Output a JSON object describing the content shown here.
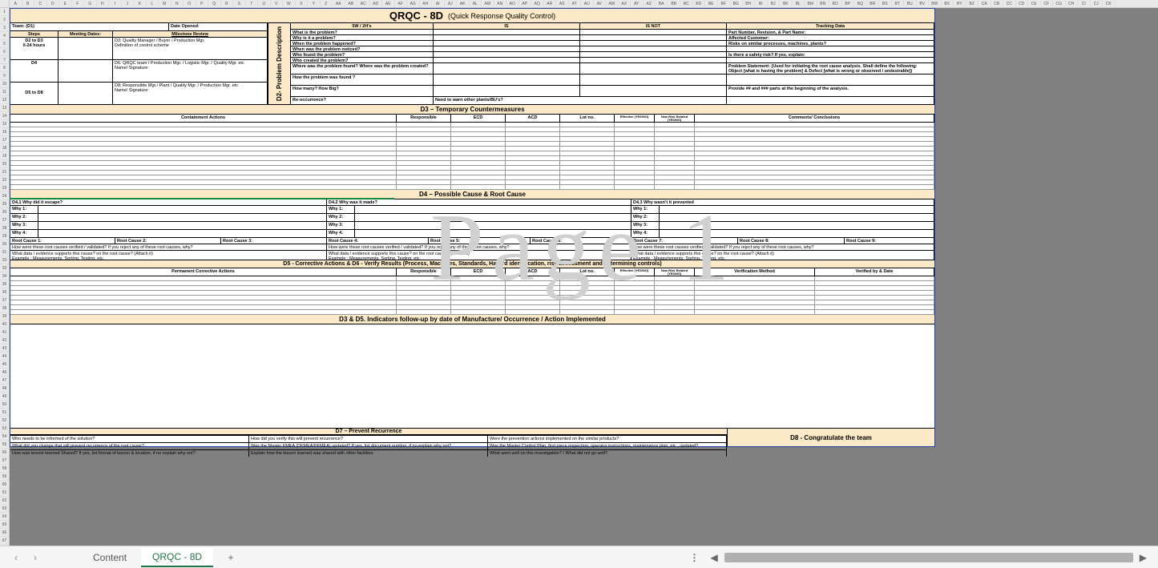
{
  "columns": [
    "A",
    "B",
    "C",
    "D",
    "E",
    "F",
    "G",
    "H",
    "I",
    "J",
    "K",
    "L",
    "M",
    "N",
    "O",
    "P",
    "Q",
    "R",
    "S",
    "T",
    "U",
    "V",
    "W",
    "X",
    "Y",
    "Z",
    "AA",
    "AB",
    "AC",
    "AD",
    "AE",
    "AF",
    "AG",
    "AH",
    "AI",
    "AJ",
    "AK",
    "AL",
    "AM",
    "AN",
    "AO",
    "AP",
    "AQ",
    "AR",
    "AS",
    "AT",
    "AU",
    "AV",
    "AW",
    "AX",
    "AY",
    "AZ",
    "BA",
    "BB",
    "BC",
    "BD",
    "BE",
    "BF",
    "BG",
    "BH",
    "BI",
    "BJ",
    "BK",
    "BL",
    "BM",
    "BN",
    "BO",
    "BP",
    "BQ",
    "BR",
    "BS",
    "BT",
    "BU",
    "BV",
    "BW",
    "BX",
    "BY",
    "BZ",
    "CA",
    "CB",
    "CC",
    "CD",
    "CE",
    "CF",
    "CG",
    "CH",
    "CI",
    "CJ",
    "CK"
  ],
  "title": {
    "main": "QRQC - 8D",
    "sub": "(Quick Response Quality Control)"
  },
  "watermark": "Page 1",
  "d1": {
    "team": "Team: (D1)",
    "date_opened": "Date Opened:",
    "steps": "Steps",
    "meeting_dates": "Meeting Dates:",
    "milestone": "Milestone Review",
    "row1_a": "D2 to D3\n0-24 hours",
    "row1_c": "D3: Quality Manager / Buyer / Production Mgr.\nDefinition of control scheme",
    "row2_a": "D4",
    "row2_c": "D6: QRQC team / Production Mgr. / Logistic Mgr. / Quality Mgr. etc\nName/ Signature:",
    "row3_a": "D5 to D8",
    "row3_c": "D8: Responsible Mgr./ Plant / Quality Mgr. / Production Mgr. etc\nName/ Signature:"
  },
  "d2": {
    "label": "D2- Problem Description",
    "hdr_5w": "5W / 2H's",
    "hdr_is": "IS",
    "hdr_isnot": "IS NOT",
    "hdr_tracking": "Tracking Data",
    "q_what": "What is the problem?",
    "q_whyprob": "Why is it a problem?",
    "q_when": "When the problem happened?",
    "q_when2": "When was the problem noticed?",
    "q_who": "Who found the problem?",
    "q_who2": "Who created the problem?",
    "q_where": "Where was the problem found? Where was the problem created?",
    "q_how": "How the problem was found ?",
    "q_howmany": "How many? How Big?",
    "q_reocc": "Re-occurrence?",
    "q_reocc2": "Need to warn other plants/BU's?",
    "t_part": "Part Number, Revision, & Part Name:",
    "t_cust": "Affected Customer:",
    "t_risk": "Risks on similar processes, machines, plants?",
    "t_safety": "Is there a safety risk? If yes, explain:",
    "t_stmt": "Problem Statement: (Used for initiating the root cause analysis. Shall define the following: Object [what is having the problem] & Defect [what is wrong or observed / undesirable])",
    "t_provide": "Provide ## and ### parts at the beginning of the analysis."
  },
  "d3": {
    "hdr": "D3 – Temporary Countermeasures",
    "cols": {
      "actions": "Containment Actions",
      "resp": "Responsible",
      "ecd": "ECD",
      "acd": "ACD",
      "lot": "Lot no.",
      "eff": "Effective (YES/NO)",
      "risk": "New Risk Related (YES/NO)",
      "comments": "Comments/ Conclusions"
    }
  },
  "d4": {
    "hdr": "D4 – Possible Cause & Root Cause",
    "col1": "D4.1 Why did it escape?",
    "col2": "D4.2 Why was it made?",
    "col3": "D4.3 Why wasn't it prevented",
    "why1": "Why 1:",
    "why2": "Why 2:",
    "why3": "Why 3:",
    "why4": "Why 4:",
    "rc1": "Root Cause 1:",
    "rc2": "Root Cause 2:",
    "rc3": "Root Cause 3:",
    "rc4": "Root Cause 4:",
    "rc5": "Root Cause 5:",
    "rc6": "Root Cause 6:",
    "rc7": "Root Cause 7:",
    "rc8": "Root Cause 8:",
    "rc9": "Root Cause 9:",
    "ver": "How were these root causes verified / validated? If you reject any of these root causes, why?",
    "evidence": "What data / evidence supports this cause? on the root cause? (Attach it)\nExample : Measurements, Sorting, Testing, etc."
  },
  "d5": {
    "hdr": "D5 - Corrective Actions &  D6 - Verify Results (Process, Machines, Standards, Hazard identification, risk assessment and determining controls)",
    "cols": {
      "actions": "Permanent Corrective Actions",
      "resp": "Responsible",
      "ecd": "ECD",
      "acd": "ACD",
      "lot": "Lot no.",
      "eff": "Effective (YES/NO)",
      "risk": "New Risk Related (YES/NO)",
      "method": "Verification Method",
      "by": "Verified by  & Date"
    }
  },
  "d35": {
    "hdr": "D3 & D5. Indicators follow-up by date of Manufacture/ Occurrence / Action Implemented"
  },
  "d7": {
    "hdr": "D7 – Prevent Recurrence",
    "q1a": "Who needs to be informed of the solution?",
    "q1b": "How did you verify this will prevent recurrence?",
    "q1c": "Were the prevention actions implemented on the similar products?",
    "q2a": "What did you change that will prevent recurrence of the root cause?",
    "q2b": "Was the Master FMEA (DFMEA/PFMEA) updated? If yes, list document number, if no explain why not?",
    "q2c": "Was the Master Control Plan, first piece inspection, operator instructions, maintenance plan, etc., updated?",
    "q3a": "How was lesson learned Shared? If yes, list format of lesson & location, if no explain why not?",
    "q3b": "Explain how the lesson learned was shared with other facilities:",
    "q3c": "What went well on this investigation? / What did not go well?"
  },
  "d8": {
    "hdr": "D8 - Congratulate the team"
  },
  "tabs": {
    "content": "Content",
    "qrqc": "QRQC - 8D"
  }
}
